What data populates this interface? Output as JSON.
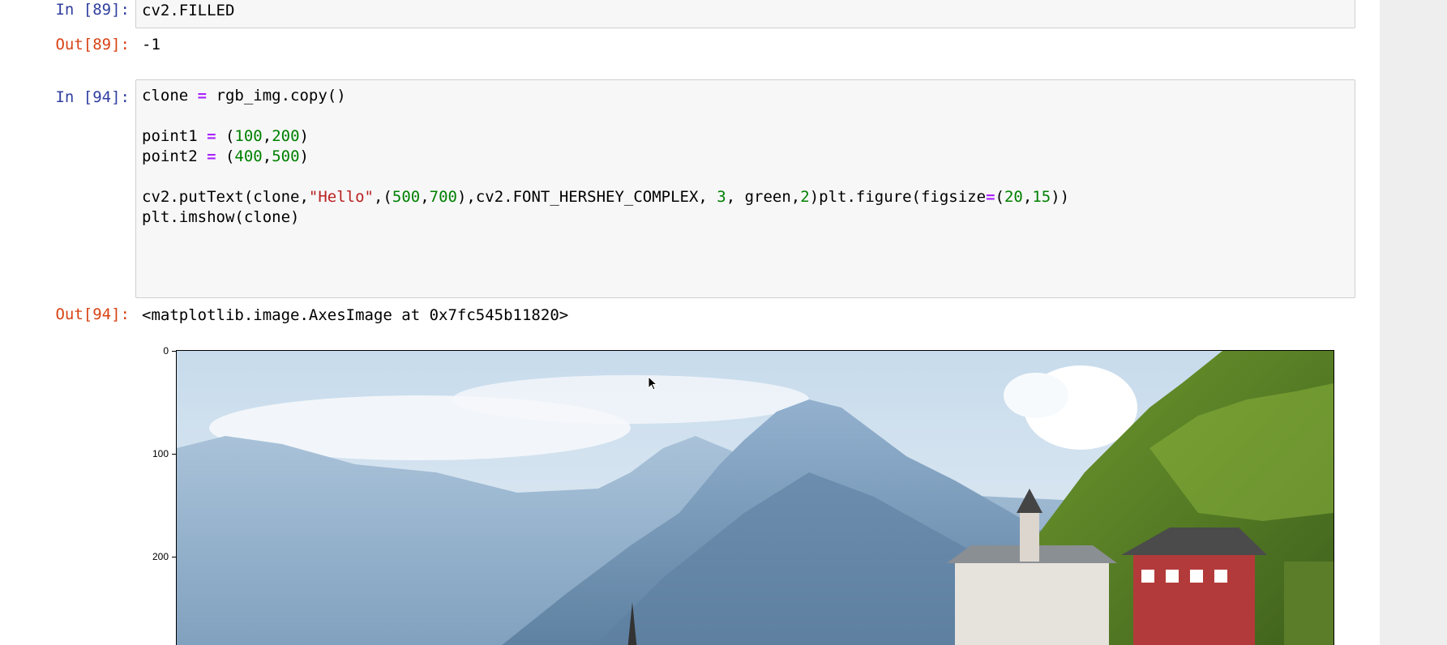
{
  "cells": {
    "cell89": {
      "in_prompt": "In [89]:",
      "code": "cv2.FILLED",
      "out_prompt": "Out[89]:",
      "output": "-1"
    },
    "cell94": {
      "in_prompt": "In [94]:",
      "code_lines": {
        "l1": {
          "a": "clone ",
          "op": "=",
          "b": " rgb_img.copy()"
        },
        "l3": {
          "a": "point1 ",
          "op": "=",
          "b": " (",
          "n1": "100",
          "c": ",",
          "n2": "200",
          "d": ")"
        },
        "l4": {
          "a": "point2 ",
          "op": "=",
          "b": " (",
          "n1": "400",
          "c": ",",
          "n2": "500",
          "d": ")"
        },
        "l6": {
          "a": "cv2.putText(clone,",
          "s": "\"Hello\"",
          "b": ",(",
          "n1": "500",
          "c": ",",
          "n2": "700",
          "d": "),cv2.FONT_HERSHEY_COMPLEX, ",
          "n3": "3",
          "e": ", green,",
          "n4": "2",
          "f": ")"
        },
        "l9": {
          "a": "plt.figure(figsize",
          "op": "=",
          "b": "(",
          "n1": "20",
          "c": ",",
          "n2": "15",
          "d": "))"
        },
        "l10": {
          "a": "plt.imshow(clone)"
        }
      },
      "out_prompt": "Out[94]:",
      "output": "<matplotlib.image.AxesImage at 0x7fc545b11820>"
    }
  },
  "plot": {
    "yticks": [
      "0",
      "100",
      "200"
    ]
  },
  "colors": {
    "in_prompt": "#303f9f",
    "out_prompt": "#d84315",
    "code_operator": "#aa22ff",
    "code_number": "#008000",
    "code_string": "#ba2121",
    "cell_background": "#f7f7f7"
  }
}
